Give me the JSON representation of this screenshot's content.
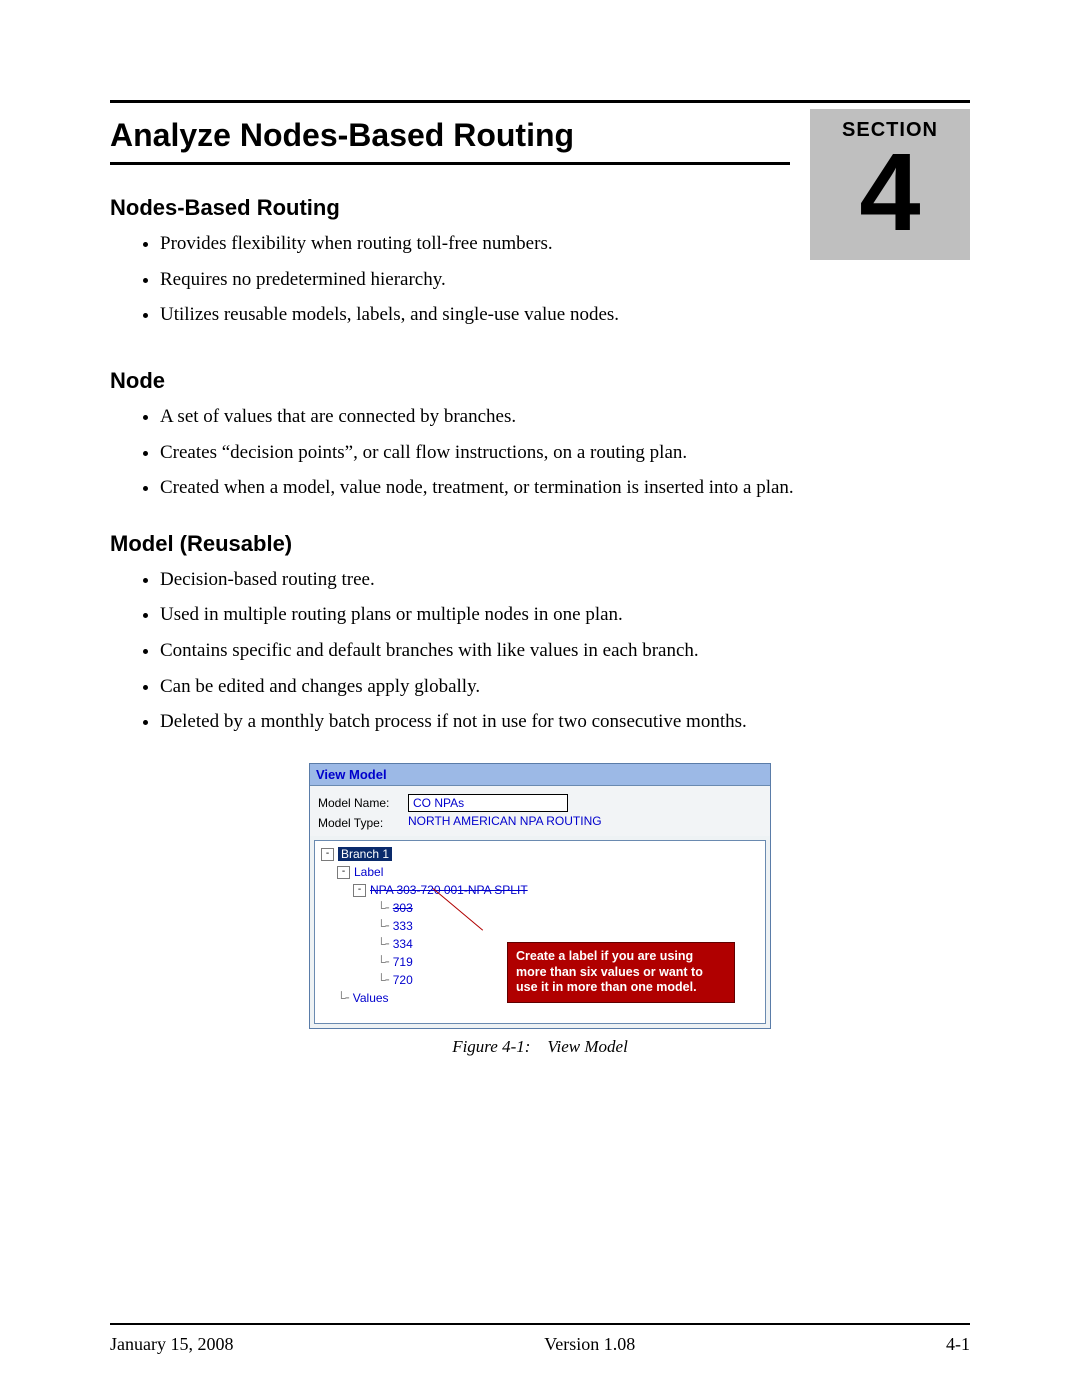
{
  "header": {
    "title": "Analyze Nodes-Based Routing",
    "section_label": "SECTION",
    "section_number": "4"
  },
  "sections": {
    "s1": {
      "heading": "Nodes-Based Routing",
      "bullets": [
        "Provides flexibility when routing toll-free numbers.",
        "Requires no predetermined hierarchy.",
        "Utilizes reusable models, labels, and single-use value nodes."
      ]
    },
    "s2": {
      "heading": "Node",
      "bullets": [
        "A set of values that are connected by branches.",
        "Creates “decision points”, or call flow instructions, on a routing plan.",
        "Created when a model, value node, treatment, or termination is inserted into a plan."
      ]
    },
    "s3": {
      "heading": "Model (Reusable)",
      "bullets": [
        "Decision-based routing tree.",
        "Used in multiple routing plans or multiple nodes in one plan.",
        "Contains specific and default branches with like values in each branch.",
        "Can be edited and changes apply globally.",
        "Deleted by a monthly batch process if not in use for two consecutive months."
      ]
    }
  },
  "figure": {
    "titlebar": "View Model",
    "model_name_label": "Model Name:",
    "model_name_value": "CO NPAs",
    "model_type_label": "Model Type:",
    "model_type_value": "NORTH AMERICAN NPA ROUTING",
    "tree": {
      "branch": "Branch 1",
      "label_node": "Label",
      "npa_node": "NPA 303-720 001-NPA SPLIT",
      "leaves": [
        "303",
        "333",
        "334",
        "719",
        "720"
      ],
      "values_node": "Values"
    },
    "callout": "Create a label if you are using more than six values or want to use it in more than one model.",
    "caption": "Figure 4-1: View Model"
  },
  "footer": {
    "left": "January 15, 2008",
    "center": "Version 1.08",
    "right": "4-1"
  }
}
